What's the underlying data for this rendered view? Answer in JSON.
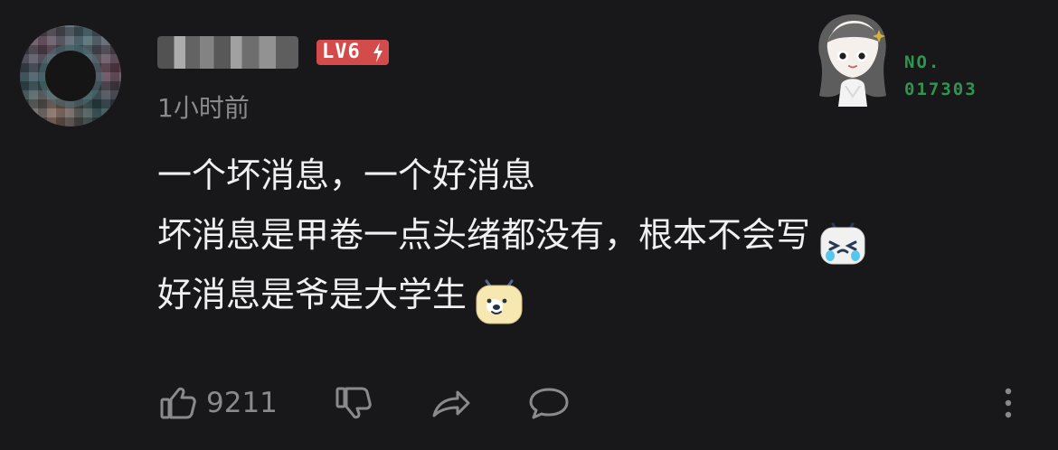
{
  "user": {
    "level_label": "LV6"
  },
  "comment": {
    "time": "1小时前",
    "lines": [
      "一个坏消息，一个好消息",
      "坏消息是甲卷一点头绪都没有，根本不会写",
      "好消息是爷是大学生"
    ]
  },
  "pendant": {
    "no_label": "NO.",
    "no_number": "017303"
  },
  "actions": {
    "like_count": "9211"
  },
  "icons": {
    "bolt": "lightning-bolt-icon",
    "like": "thumbs-up-icon",
    "dislike": "thumbs-down-icon",
    "share": "share-icon",
    "reply": "reply-icon",
    "more": "more-vertical-icon",
    "emoji_1": "crying-emoji-icon",
    "emoji_2": "dog-emoji-icon"
  },
  "colors": {
    "background": "#18181a",
    "text": "#f0f0f0",
    "muted": "#8a8a8a",
    "badge": "#d44b4b",
    "pendant_number": "#2f9650"
  }
}
